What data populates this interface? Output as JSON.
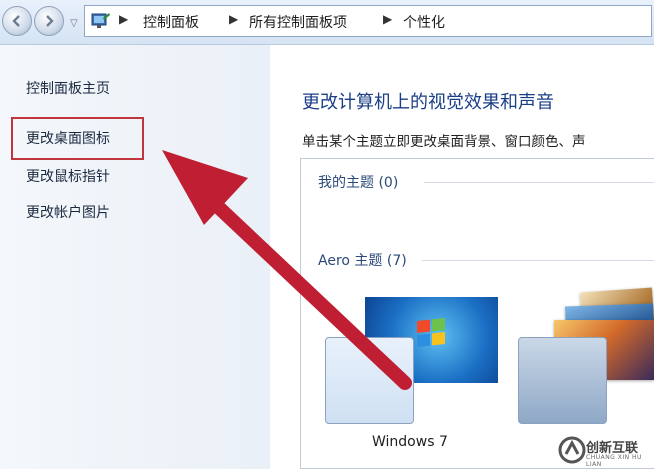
{
  "breadcrumb": {
    "items": [
      "控制面板",
      "所有控制面板项",
      "个性化"
    ]
  },
  "sidebar": {
    "items": [
      {
        "label": "控制面板主页"
      },
      {
        "label": "更改桌面图标"
      },
      {
        "label": "更改鼠标指针"
      },
      {
        "label": "更改帐户图片"
      }
    ],
    "highlighted": "更改桌面图标"
  },
  "main": {
    "title": "更改计算机上的视觉效果和声音",
    "description": "单击某个主题立即更改桌面背景、窗口颜色、声",
    "groups": [
      {
        "label": "我的主题 (0)"
      },
      {
        "label": "Aero 主题 (7)"
      }
    ],
    "themes": [
      {
        "label": "Windows 7"
      }
    ]
  },
  "annotation": {
    "arrow_color": "#c01f33"
  },
  "watermark": {
    "brand": "创新互联",
    "sub": "CHUANG XIN HU LIAN"
  },
  "icons": [
    "back-icon",
    "forward-icon",
    "control-panel-icon",
    "chevron-right-icon",
    "dropdown-icon"
  ]
}
